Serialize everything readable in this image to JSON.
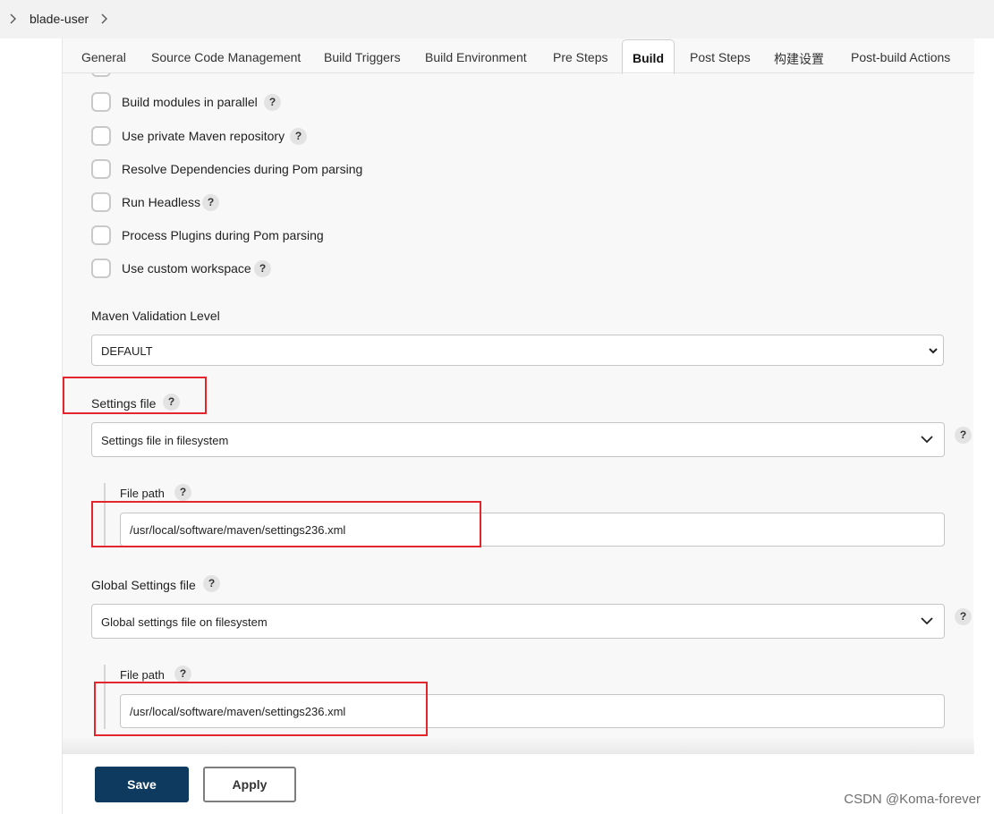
{
  "breadcrumb": {
    "job_name": "blade-user"
  },
  "tabs": [
    {
      "label": "General"
    },
    {
      "label": "Source Code Management"
    },
    {
      "label": "Build Triggers"
    },
    {
      "label": "Build Environment"
    },
    {
      "label": "Pre Steps"
    },
    {
      "label": "Build"
    },
    {
      "label": "Post Steps"
    },
    {
      "label": "构建设置"
    },
    {
      "label": "Post-build Actions"
    }
  ],
  "options": [
    {
      "label": "Build modules in parallel",
      "checked": false,
      "help": "?"
    },
    {
      "label": "Use private Maven repository",
      "checked": false,
      "help": "?"
    },
    {
      "label": "Resolve Dependencies during Pom parsing",
      "checked": false
    },
    {
      "label": "Run Headless",
      "checked": false,
      "help": "?"
    },
    {
      "label": "Process Plugins during Pom parsing",
      "checked": false
    },
    {
      "label": "Use custom workspace",
      "checked": false,
      "help": "?"
    }
  ],
  "maven_validation": {
    "label": "Maven Validation Level",
    "value": "DEFAULT"
  },
  "settings_file": {
    "label": "Settings file",
    "help": "?",
    "value": "Settings file in filesystem",
    "file_path_label": "File path",
    "file_path_value": "/usr/local/software/maven/settings236.xml"
  },
  "global_settings_file": {
    "label": "Global Settings file",
    "help": "?",
    "value": "Global settings file on filesystem",
    "file_path_label": "File path",
    "file_path_value": "/usr/local/software/maven/settings236.xml"
  },
  "footer": {
    "save_label": "Save",
    "apply_label": "Apply"
  },
  "watermark": "CSDN @Koma-forever",
  "colors": {
    "save_bg": "#0d3a5e",
    "annotation_red": "#e3262b"
  }
}
